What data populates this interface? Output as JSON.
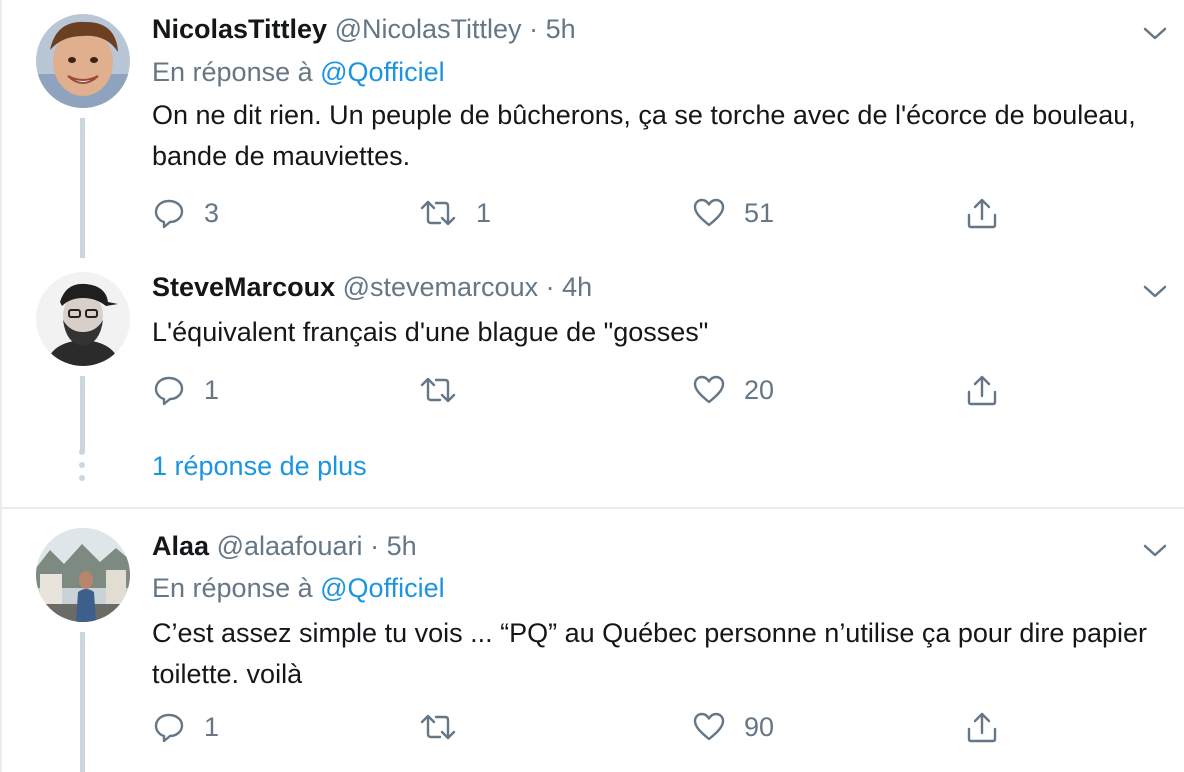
{
  "tweets": [
    {
      "name": "NicolasTittley",
      "handle": "@NicolasTittley",
      "dot": "·",
      "time": "5h",
      "reply_prefix": "En réponse à",
      "reply_mention": "@Qofficiel",
      "text": "On ne dit rien. Un peuple de bûcherons, ça se torche avec de l'écorce de bouleau, bande de mauviettes.",
      "replies": "3",
      "retweets": "1",
      "likes": "51"
    },
    {
      "name": "SteveMarcoux",
      "handle": "@stevemarcoux",
      "dot": "·",
      "time": "4h",
      "text": "L'équivalent français d'une blague de \"gosses\"",
      "replies": "1",
      "retweets": "",
      "likes": "20"
    },
    {
      "name": "Alaa",
      "handle": "@alaafouari",
      "dot": "·",
      "time": "5h",
      "reply_prefix": "En réponse à",
      "reply_mention": "@Qofficiel",
      "text": "C’est assez simple tu vois ... “PQ” au Québec personne n’utilise ça pour dire papier toilette. voilà",
      "replies": "1",
      "retweets": "",
      "likes": "90"
    }
  ],
  "more_replies_label": "1 réponse de plus",
  "icons": {
    "reply": "reply-icon",
    "retweet": "retweet-icon",
    "like": "heart-icon",
    "share": "share-icon",
    "menu": "chevron-down-icon"
  },
  "colors": {
    "link": "#1b95e0",
    "muted": "#657786",
    "text": "#14171a",
    "thread_line": "#ccd6dd",
    "border": "#e6ecf0"
  }
}
